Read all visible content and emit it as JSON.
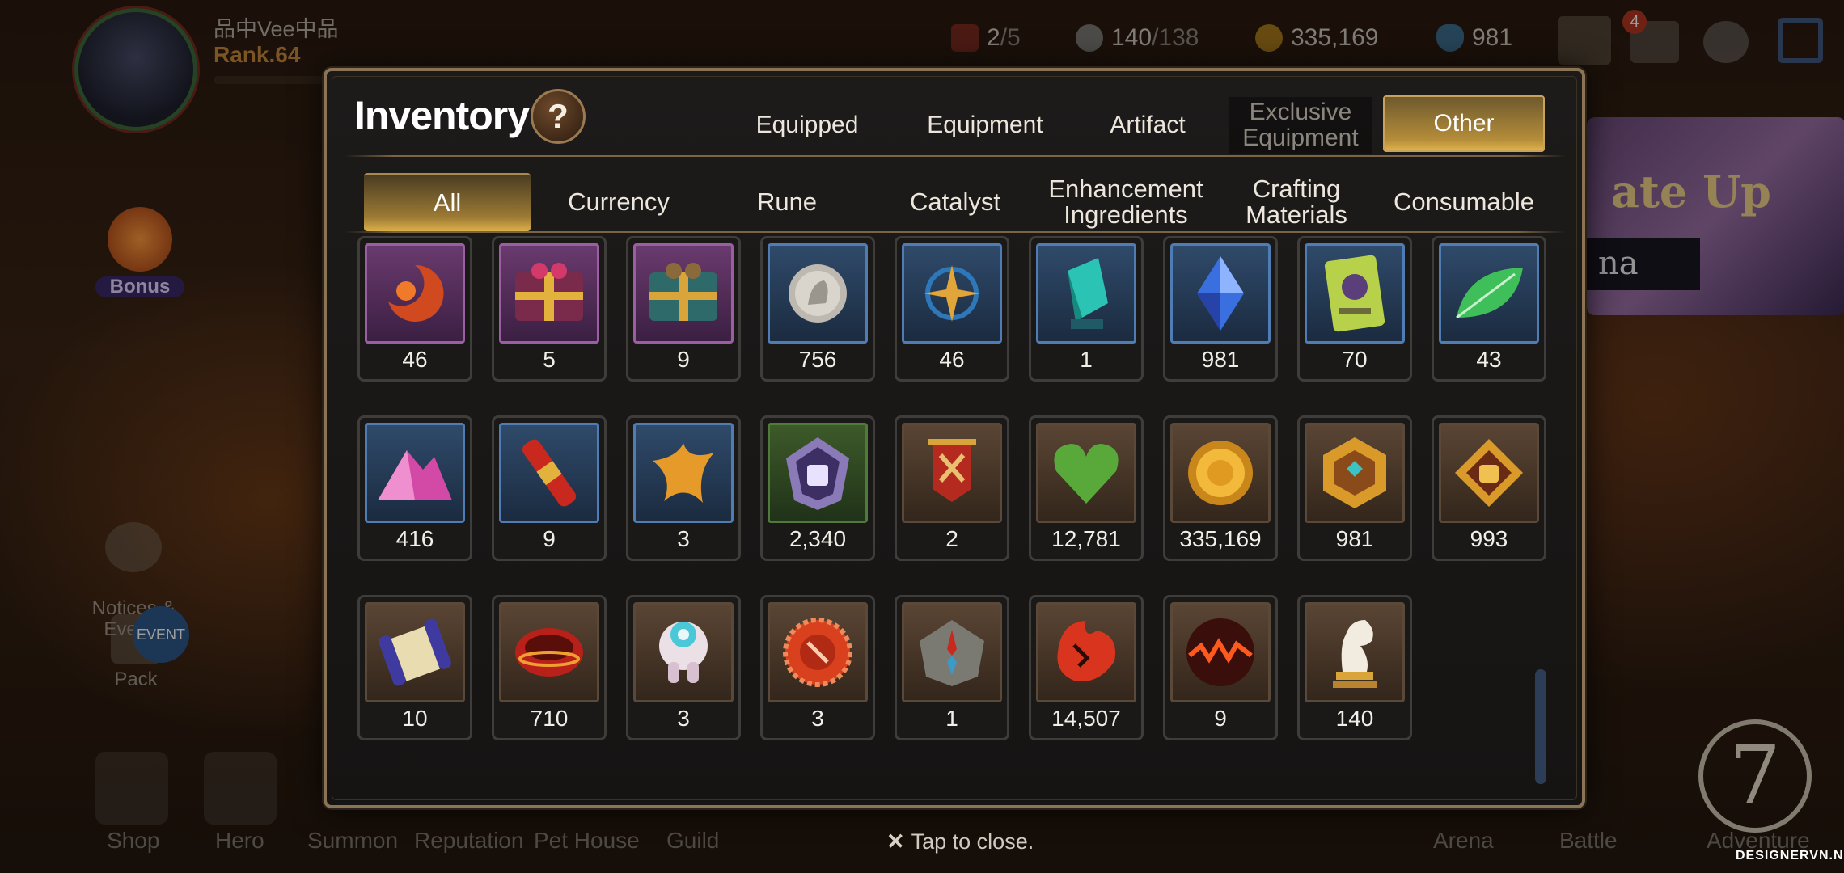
{
  "player": {
    "name": "品中Vee中品",
    "rank": "Rank.64"
  },
  "resources": [
    {
      "icon": "stamina-icon",
      "value": "2",
      "max": "/5"
    },
    {
      "icon": "energy-icon",
      "value": "140",
      "max": "/138"
    },
    {
      "icon": "gold-coin-icon",
      "value": "335,169",
      "max": ""
    },
    {
      "icon": "crystal-icon",
      "value": "981",
      "max": ""
    }
  ],
  "top_badges": {
    "mail_count": "4"
  },
  "side": {
    "bonus": "Bonus",
    "notices": "Notices &\nEvents",
    "event": "EVENT",
    "pack": "Pack"
  },
  "bottom_nav": [
    "Shop",
    "Hero",
    "Summon",
    "Reputation",
    "Pet House",
    "Guild",
    "Arena",
    "Battle",
    "Adventure"
  ],
  "banner": {
    "text": "ate Up",
    "strip": "na"
  },
  "adventure_icon": "7",
  "inventory": {
    "title": "Inventory",
    "help": "?",
    "main_tabs": [
      "Equipped",
      "Equipment",
      "Artifact",
      "Exclusive\nEquipment",
      "Other"
    ],
    "main_active": "Other",
    "sub_tabs": [
      "All",
      "Currency",
      "Rune",
      "Catalyst",
      "Enhancement\nIngredients",
      "Crafting\nMaterials",
      "Consumable"
    ],
    "sub_active": "All",
    "items": [
      {
        "icon": "orange-crescent-rune-icon",
        "count": "46",
        "frame": "purple"
      },
      {
        "icon": "pink-gift-box-icon",
        "count": "5",
        "frame": "purple"
      },
      {
        "icon": "teal-gift-box-icon",
        "count": "9",
        "frame": "purple"
      },
      {
        "icon": "silver-coin-icon",
        "count": "756",
        "frame": "blue"
      },
      {
        "icon": "compass-star-pendant-icon",
        "count": "46",
        "frame": "blue"
      },
      {
        "icon": "teal-crystal-shard-icon",
        "count": "1",
        "frame": "blue"
      },
      {
        "icon": "blue-gem-icon",
        "count": "981",
        "frame": "blue"
      },
      {
        "icon": "green-card-icon",
        "count": "70",
        "frame": "blue"
      },
      {
        "icon": "green-leaf-icon",
        "count": "43",
        "frame": "blue"
      },
      {
        "icon": "pink-ore-pile-icon",
        "count": "416",
        "frame": "blue"
      },
      {
        "icon": "red-scroll-tube-icon",
        "count": "9",
        "frame": "blue"
      },
      {
        "icon": "orange-starfish-icon",
        "count": "3",
        "frame": "blue"
      },
      {
        "icon": "fist-emblem-icon",
        "count": "2,340",
        "frame": "green"
      },
      {
        "icon": "battle-banner-icon",
        "count": "2",
        "frame": "brown"
      },
      {
        "icon": "green-heart-icon",
        "count": "12,781",
        "frame": "brown"
      },
      {
        "icon": "gold-sun-coin-icon",
        "count": "335,169",
        "frame": "brown"
      },
      {
        "icon": "gold-hexagon-medal-icon",
        "count": "981",
        "frame": "brown"
      },
      {
        "icon": "fist-medal-icon",
        "count": "993",
        "frame": "brown"
      },
      {
        "icon": "scroll-icon",
        "count": "10",
        "frame": "brown"
      },
      {
        "icon": "red-ring-icon",
        "count": "710",
        "frame": "brown"
      },
      {
        "icon": "robot-pet-icon",
        "count": "3",
        "frame": "brown"
      },
      {
        "icon": "red-bottle-cap-icon",
        "count": "3",
        "frame": "brown"
      },
      {
        "icon": "stone-compass-icon",
        "count": "1",
        "frame": "brown"
      },
      {
        "icon": "red-leaf-icon",
        "count": "14,507",
        "frame": "brown"
      },
      {
        "icon": "fire-orb-icon",
        "count": "9",
        "frame": "brown"
      },
      {
        "icon": "chess-knight-icon",
        "count": "140",
        "frame": "brown"
      }
    ]
  },
  "tap_to_close": "Tap to close.",
  "watermark": "DESIGNERVN.NET",
  "colors": {
    "accent_gold": "#d7ad4a",
    "panel_border": "#8a7455",
    "frame_purple": "#9a5fa0",
    "frame_blue": "#4f7cb3"
  }
}
